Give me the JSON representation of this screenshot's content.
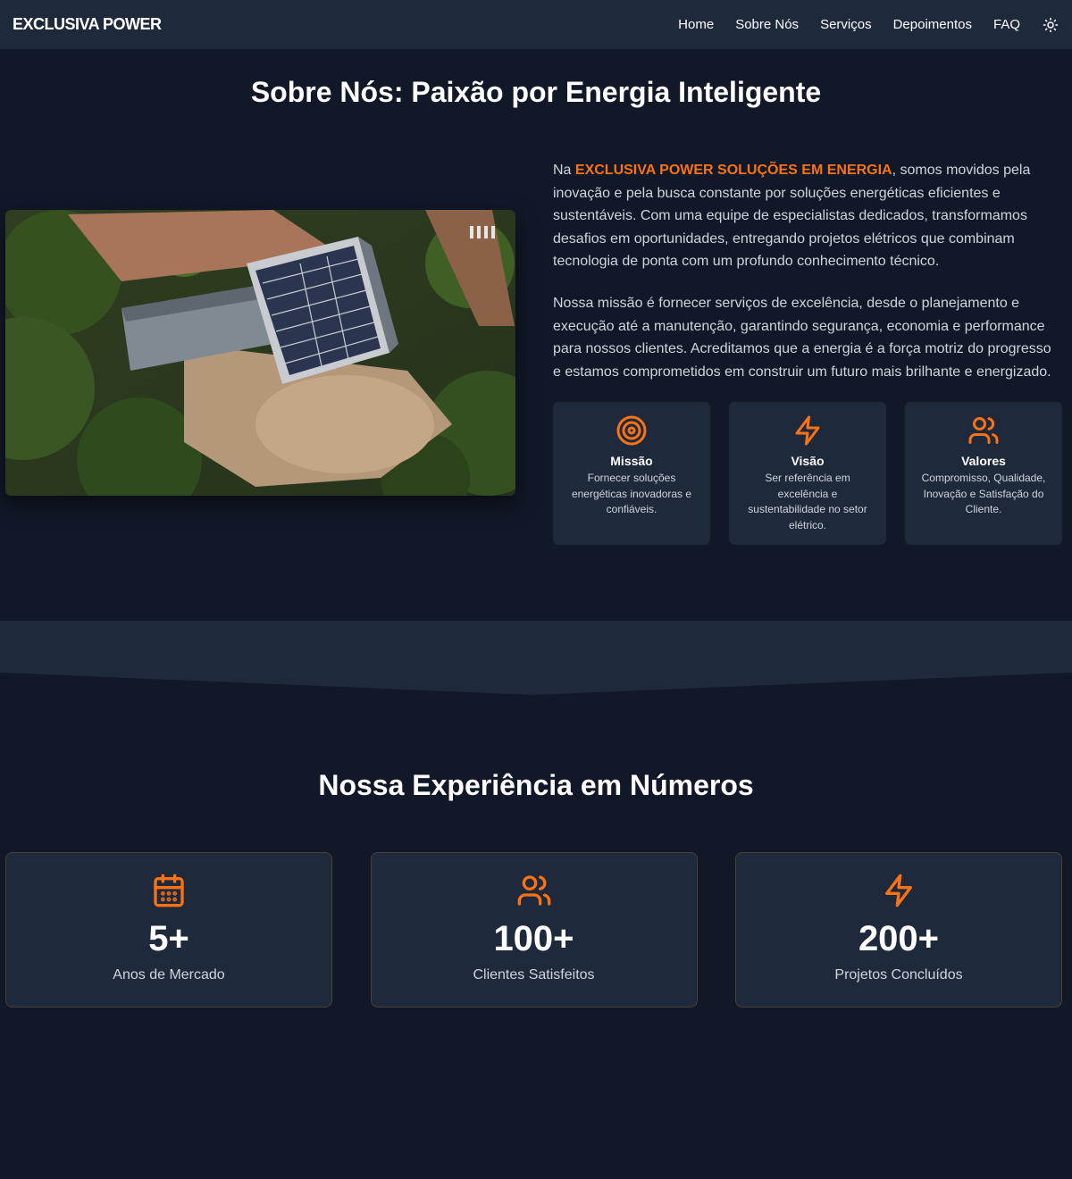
{
  "nav": {
    "brand": "EXCLUSIVA POWER",
    "links": [
      "Home",
      "Sobre Nós",
      "Serviços",
      "Depoimentos",
      "FAQ"
    ],
    "theme_icon": "sun-icon"
  },
  "about": {
    "title": "Sobre Nós: Paixão por Energia Inteligente",
    "p1_prefix": "Na ",
    "p1_highlight": "EXCLUSIVA POWER SOLUÇÕES EM ENERGIA",
    "p1_suffix": ", somos movidos pela inovação e pela busca constante por soluções energéticas eficientes e sustentáveis. Com uma equipe de especialistas dedicados, transformamos desafios em oportunidades, entregando projetos elétricos que combinam tecnologia de ponta com um profundo conhecimento técnico.",
    "p2": "Nossa missão é fornecer serviços de excelência, desde o planejamento e execução até a manutenção, garantindo segurança, economia e performance para nossos clientes. Acreditamos que a energia é a força motriz do progresso e estamos comprometidos em construir um futuro mais brilhante e energizado.",
    "cards": [
      {
        "icon": "target-icon",
        "title": "Missão",
        "desc": "Fornecer soluções energéticas inovadoras e confiáveis."
      },
      {
        "icon": "lightning-icon",
        "title": "Visão",
        "desc": "Ser referência em excelência e sustentabilidade no setor elétrico."
      },
      {
        "icon": "users-icon",
        "title": "Valores",
        "desc": "Compromisso, Qualidade, Inovação e Satisfação do Cliente."
      }
    ]
  },
  "stats": {
    "title": "Nossa Experiência em Números",
    "items": [
      {
        "icon": "calendar-icon",
        "value": "5+",
        "label": "Anos de Mercado"
      },
      {
        "icon": "users-icon",
        "value": "100+",
        "label": "Clientes Satisfeitos"
      },
      {
        "icon": "lightning-icon",
        "value": "200+",
        "label": "Projetos Concluídos"
      }
    ]
  },
  "colors": {
    "accent": "#f97316",
    "background": "#111827",
    "surface": "#1e293b"
  }
}
